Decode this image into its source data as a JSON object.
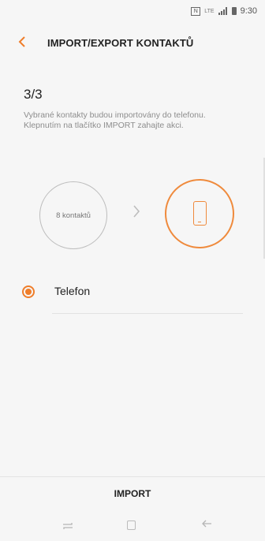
{
  "status_bar": {
    "nfc": "N",
    "lte": "LTE",
    "time": "9:30"
  },
  "header": {
    "back_icon": "chevron-left-icon",
    "title": "IMPORT/EXPORT KONTAKTŮ"
  },
  "step": {
    "number": "3/3",
    "description": "Vybrané kontakty budou importovány do telefonu. Klepnutím na tlačítko IMPORT zahajte akci."
  },
  "transfer": {
    "source_label": "8 kontaktů",
    "arrow_icon": "chevron-right-icon",
    "target_icon": "phone-icon"
  },
  "option": {
    "label": "Telefon",
    "selected": true
  },
  "import_bar": {
    "button_label": "IMPORT"
  },
  "nav_bar": {
    "recent_icon": "recent-apps-icon",
    "home_icon": "home-icon",
    "back_icon": "back-icon"
  },
  "colors": {
    "accent": "#ef7d2a",
    "background": "#f6f6f6"
  }
}
